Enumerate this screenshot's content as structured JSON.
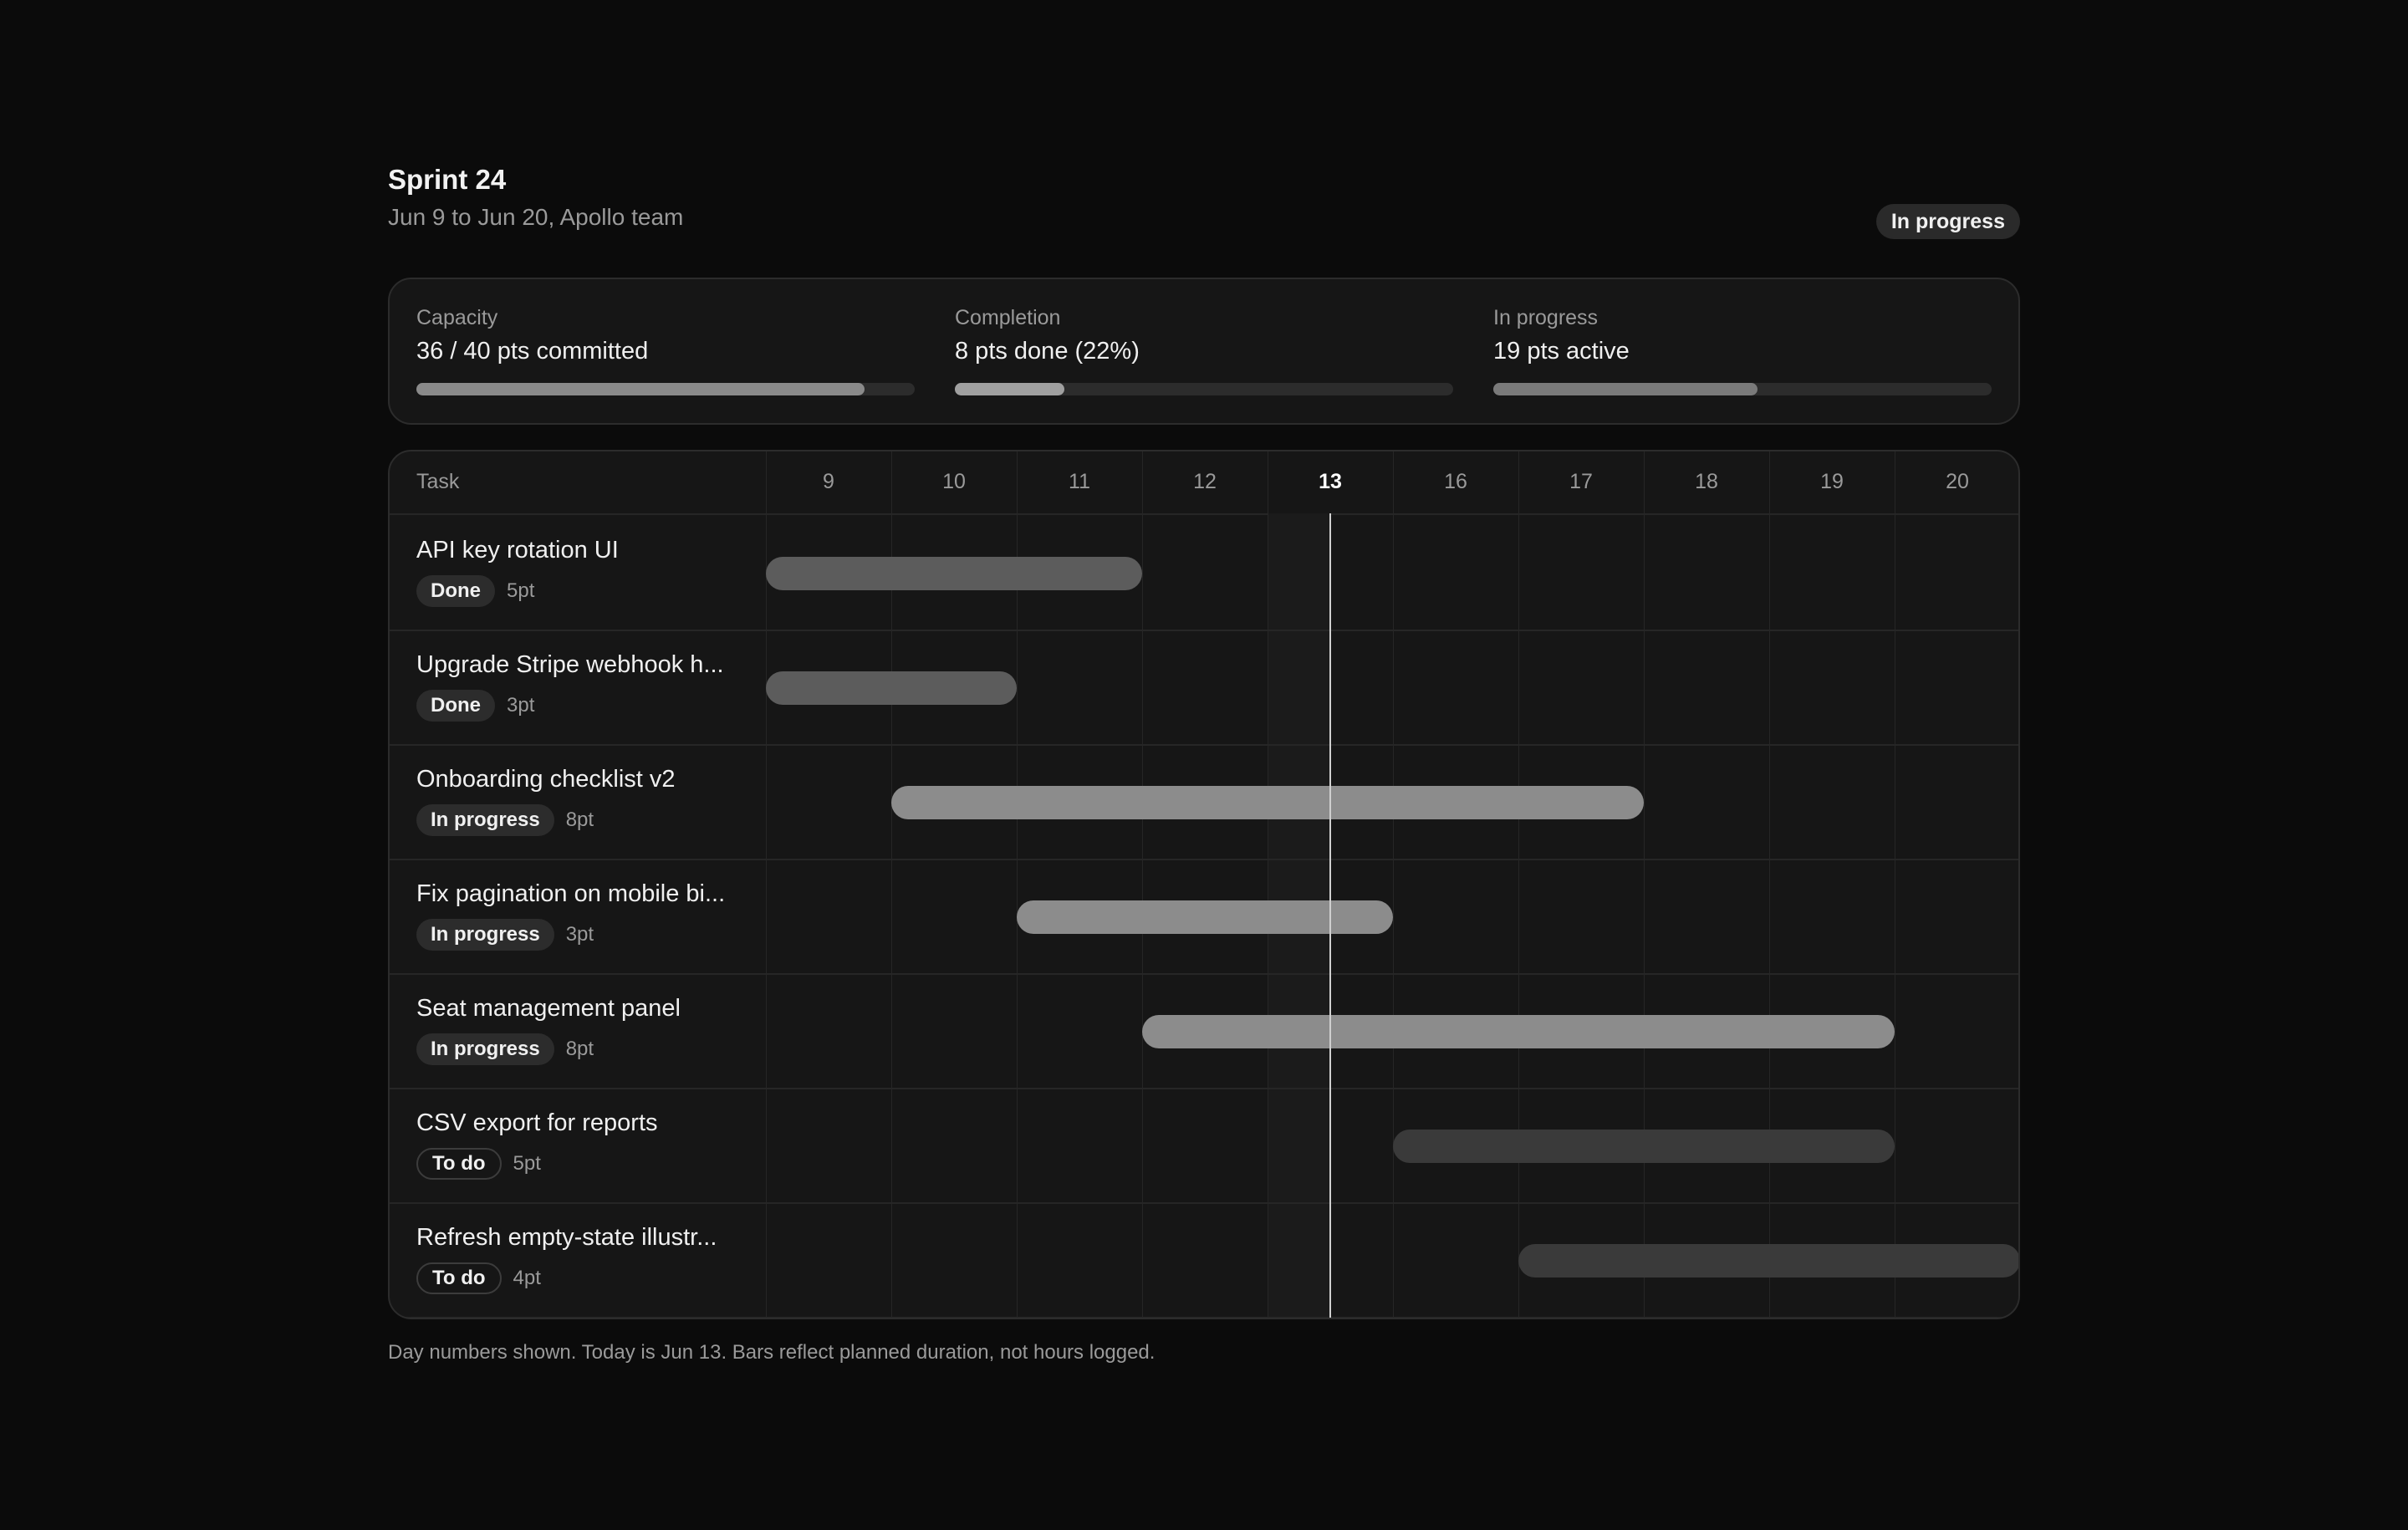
{
  "sprint": {
    "title": "Sprint 24",
    "subtitle": "Jun 9 to Jun 20, Apollo team",
    "status": "In progress"
  },
  "metrics": [
    {
      "label": "Capacity",
      "value": "36 / 40 pts committed",
      "progress": 0.9,
      "color": "#8a8a8a"
    },
    {
      "label": "Completion",
      "value": "8 pts done (22%)",
      "progress": 0.22,
      "color": "#a0a0a0"
    },
    {
      "label": "In progress",
      "value": "19 pts active",
      "progress": 0.53,
      "color": "#7a7a7a"
    }
  ],
  "gantt": {
    "task_header": "Task",
    "days": [
      "9",
      "10",
      "11",
      "12",
      "13",
      "16",
      "17",
      "18",
      "19",
      "20"
    ],
    "today": "13",
    "tasks": [
      {
        "name": "API key rotation UI",
        "status": "Done",
        "points": "5pt",
        "start": "9",
        "end": "11"
      },
      {
        "name": "Upgrade Stripe webhook h...",
        "status": "Done",
        "points": "3pt",
        "start": "9",
        "end": "10"
      },
      {
        "name": "Onboarding checklist v2",
        "status": "In progress",
        "points": "8pt",
        "start": "10",
        "end": "17"
      },
      {
        "name": "Fix pagination on mobile bi...",
        "status": "In progress",
        "points": "3pt",
        "start": "11",
        "end": "13"
      },
      {
        "name": "Seat management panel",
        "status": "In progress",
        "points": "8pt",
        "start": "12",
        "end": "19"
      },
      {
        "name": "CSV export for reports",
        "status": "To do",
        "points": "5pt",
        "start": "16",
        "end": "19"
      },
      {
        "name": "Refresh empty-state illustr...",
        "status": "To do",
        "points": "4pt",
        "start": "17",
        "end": "20"
      }
    ]
  },
  "status_colors": {
    "Done": "#5c5c5c",
    "In progress": "#8c8c8c",
    "To do": "#3a3a3a"
  },
  "footnote": "Day numbers shown. Today is Jun 13. Bars reflect planned duration, not hours logged."
}
